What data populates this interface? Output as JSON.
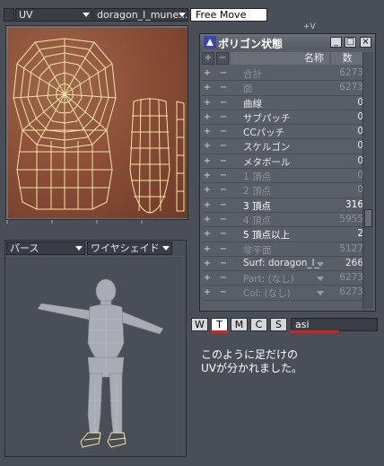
{
  "toolbar": {
    "mode_dropdown": "",
    "uv_dropdown": "UV",
    "surface_dropdown": "doragon_l_mune...",
    "tool_label": "Free Move",
    "axis_label": "+V"
  },
  "view": {
    "projection_dropdown": "パース",
    "shading_dropdown": "ワイヤシェイド"
  },
  "polygon_window": {
    "title": "ポリゴン状態",
    "header": {
      "plus": "+",
      "minus": "−",
      "name": "名称",
      "count": "数"
    },
    "minimize_label": "_",
    "maximize_label": "□",
    "close_label": "×",
    "rows": [
      {
        "name": "合計",
        "value": "6273",
        "style": "gray",
        "dropdown": false
      },
      {
        "name": "面",
        "value": "6273",
        "style": "gray",
        "dropdown": false
      },
      {
        "name": "曲線",
        "value": "0",
        "style": "white",
        "dropdown": false
      },
      {
        "name": "サブパッチ",
        "value": "0",
        "style": "white",
        "dropdown": false
      },
      {
        "name": "CCパッチ",
        "value": "0",
        "style": "white",
        "dropdown": false
      },
      {
        "name": "スケルゴン",
        "value": "0",
        "style": "white",
        "dropdown": false
      },
      {
        "name": "メタボール",
        "value": "0",
        "style": "white",
        "dropdown": false
      },
      {
        "name": "1 頂点",
        "value": "0",
        "style": "gray",
        "dropdown": false
      },
      {
        "name": "2 頂点",
        "value": "0",
        "style": "gray",
        "dropdown": false
      },
      {
        "name": "3 頂点",
        "value": "316",
        "style": "bright",
        "dropdown": false
      },
      {
        "name": "4 頂点",
        "value": "5955",
        "style": "gray",
        "dropdown": false
      },
      {
        "name": "5 頂点以上",
        "value": "2",
        "style": "bright",
        "dropdown": false
      },
      {
        "name": "非平面",
        "value": "5127",
        "style": "gray",
        "dropdown": false
      },
      {
        "name": "Surf: doragon_l_",
        "value": "266",
        "style": "white",
        "dropdown": true
      },
      {
        "name": "Part: (なし)",
        "value": "6273",
        "style": "gray",
        "dropdown": true
      },
      {
        "name": "Col: (なし)",
        "value": "6273",
        "style": "gray",
        "dropdown": true
      }
    ]
  },
  "bottom_toolbar": {
    "buttons": [
      "W",
      "T",
      "M",
      "C",
      "S"
    ],
    "selected": "T",
    "map_field": "asi"
  },
  "caption": {
    "line1": "このように足だけの",
    "line2": "UVが分かれました。"
  },
  "colors": {
    "background": "#4a4e57",
    "texture": "#8c4f37",
    "wireframe": "#f3e6a0",
    "highlight": "#d42020"
  }
}
